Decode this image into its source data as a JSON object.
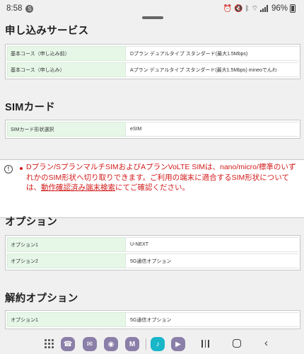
{
  "status_bar": {
    "time": "8:58",
    "notification_badge": "S",
    "battery": "96%",
    "icons": [
      "alarm-icon",
      "mute-icon",
      "bluetooth-icon",
      "wifi-icon",
      "signal-icon",
      "battery-icon"
    ]
  },
  "sections": {
    "application": {
      "title": "申し込みサービス",
      "rows": [
        {
          "label": "基本コース（申し込み前）",
          "value": "Dプラン デュアルタイプ スタンダード(最大1.5Mbps)"
        },
        {
          "label": "基本コース（申し込み）",
          "value": "Aプラン デュアルタイプ スタンダード(最大1.5Mbps)  mineoでんわ"
        }
      ]
    },
    "sim": {
      "title": "SIMカード",
      "rows": [
        {
          "label": "SIMカード形状選択",
          "value": "eSIM"
        }
      ]
    },
    "notice": {
      "text_before_link": "Dプラン/SプランマルチSIMおよびAプランVoLTE SIMは、nano/micro/標準のいずれかのSIM形状へ切り取りできます。ご利用の端末に適合するSIM形状については、",
      "link_text": "動作確認済み端末検索",
      "text_after_link": "にてご確認ください。"
    },
    "options": {
      "title": "オプション",
      "rows": [
        {
          "label": "オプション1",
          "value": "U-NEXT"
        },
        {
          "label": "オプション2",
          "value": "5G通信オプション"
        }
      ]
    },
    "cancel_options": {
      "title": "解約オプション",
      "rows": [
        {
          "label": "オプション1",
          "value": "5G通信オプション"
        }
      ]
    }
  },
  "nav_bar": {
    "apps": [
      {
        "name": "phone-app-icon",
        "glyph": "☎",
        "color": "#8a7fa8"
      },
      {
        "name": "messages-app-icon",
        "glyph": "✉",
        "color": "#8a7fa8"
      },
      {
        "name": "chrome-app-icon",
        "glyph": "◉",
        "color": "#8a7fa8"
      },
      {
        "name": "gmail-app-icon",
        "glyph": "M",
        "color": "#8a7fa8"
      },
      {
        "name": "music-app-icon",
        "glyph": "♪",
        "color": "#17b6c8"
      },
      {
        "name": "youtube-app-icon",
        "glyph": "▶",
        "color": "#8a7fa8"
      }
    ]
  }
}
